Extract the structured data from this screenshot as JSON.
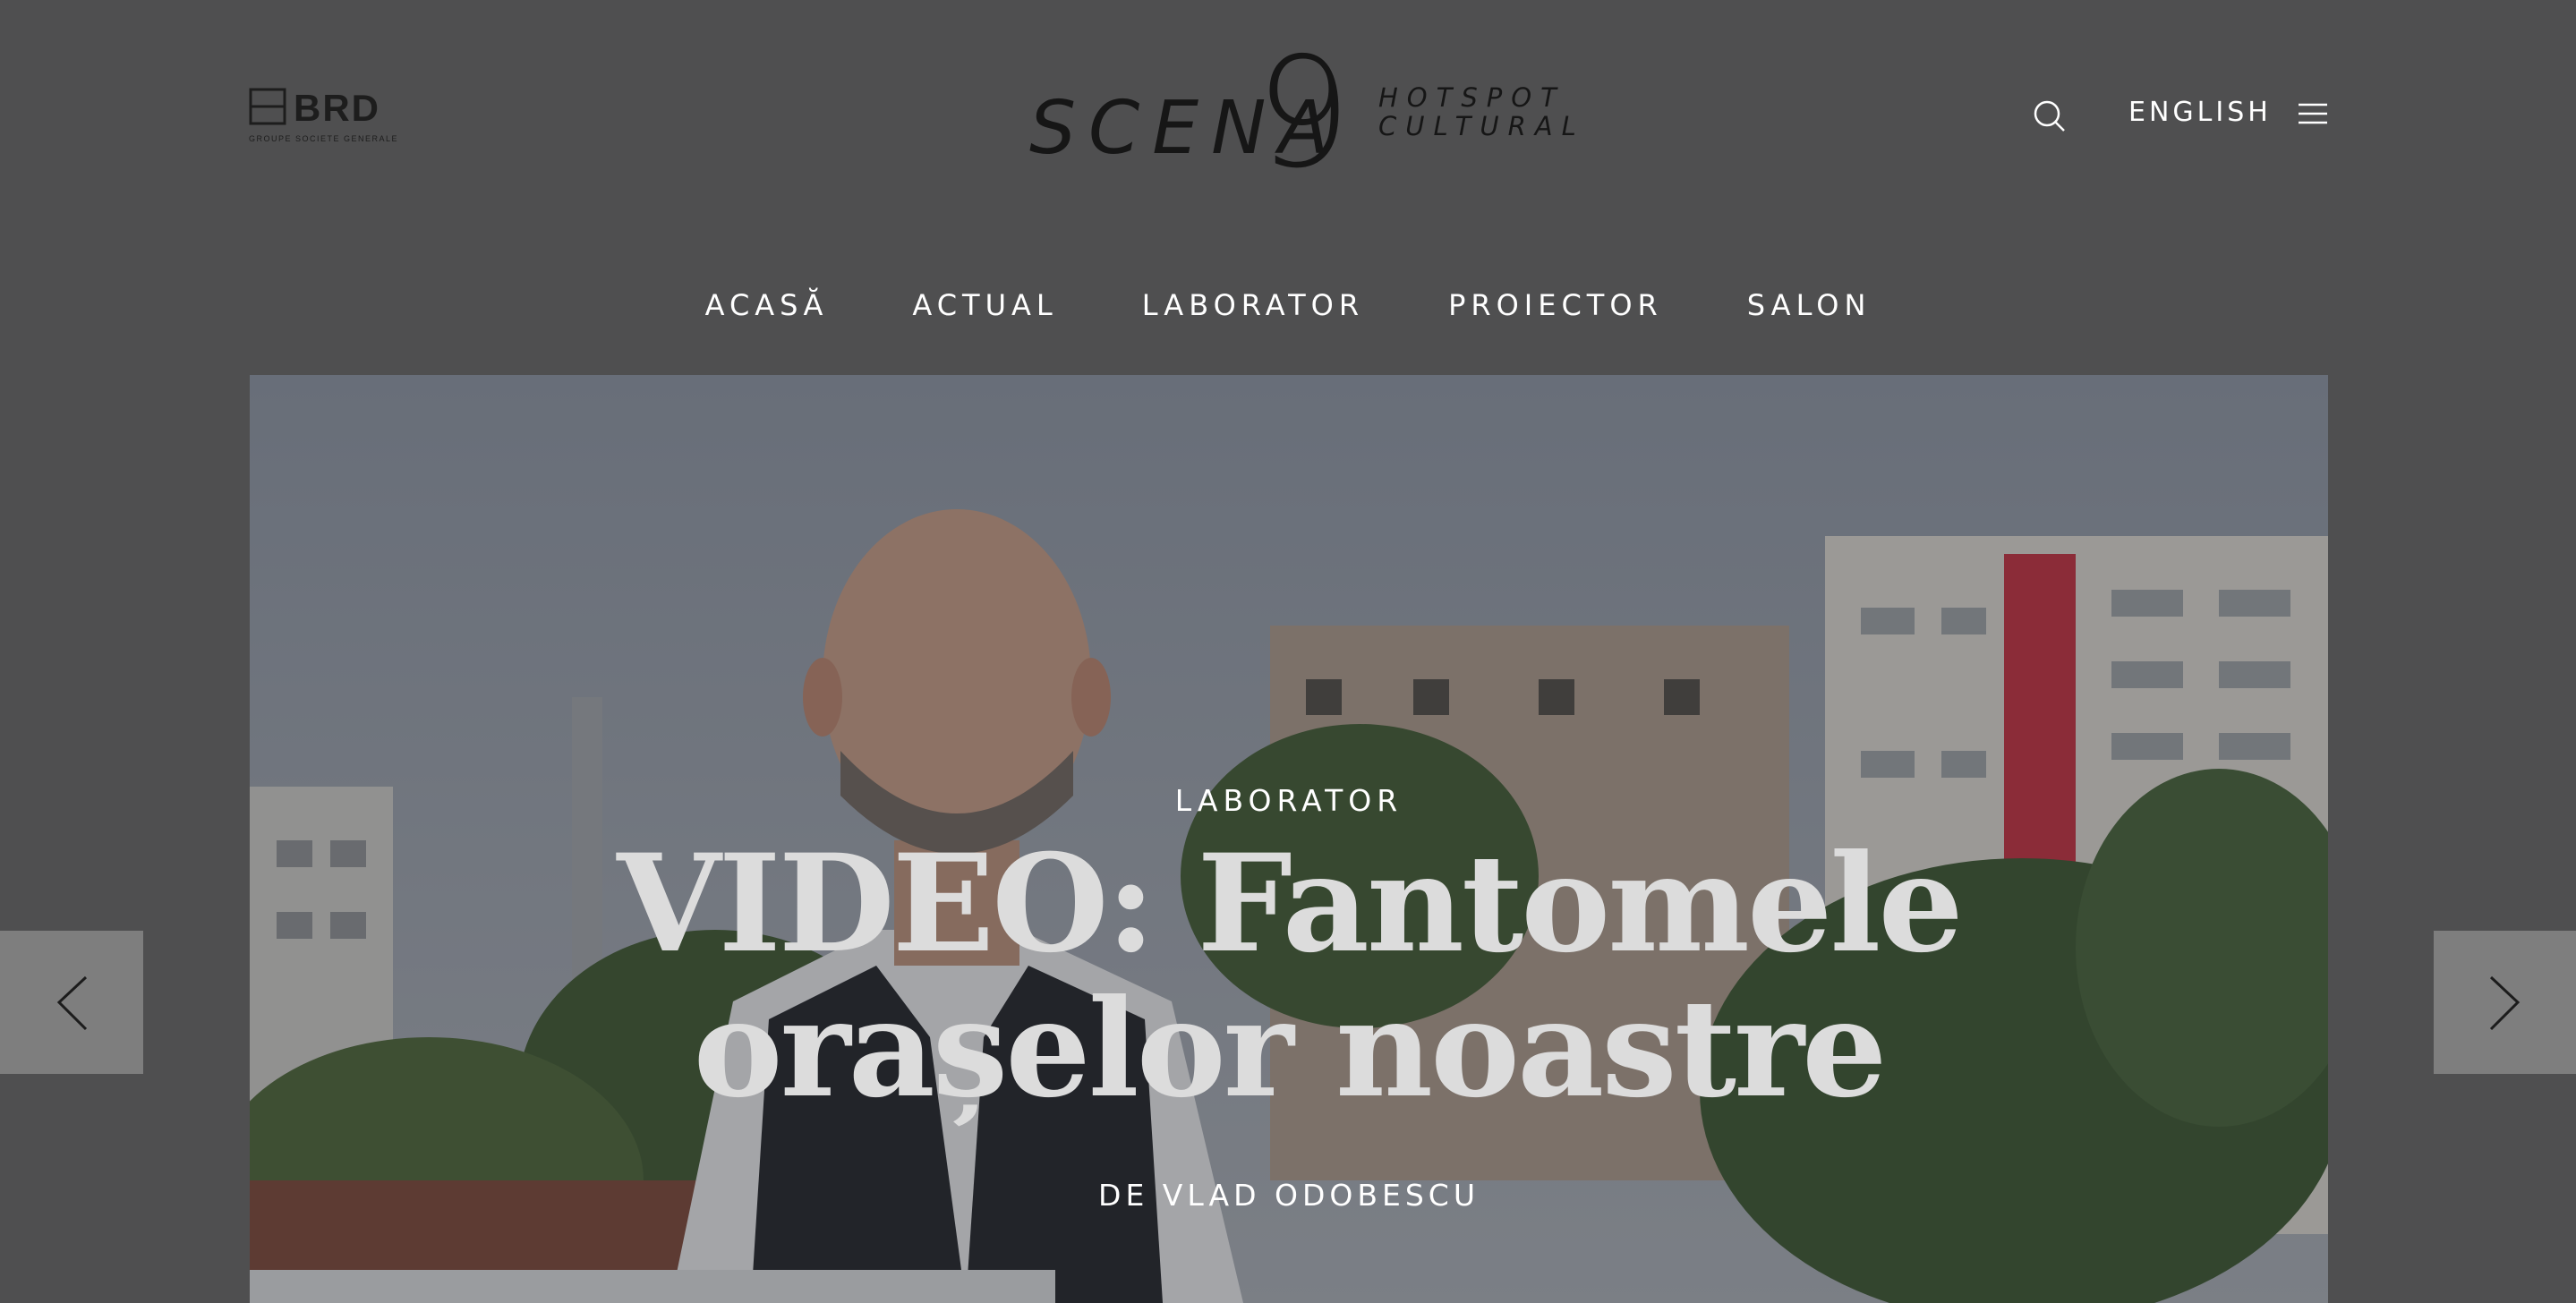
{
  "header": {
    "brd_logo": {
      "name": "BRD",
      "subtitle": "GROUPE SOCIETE GENERALE"
    },
    "site_logo": {
      "word": "SCENA",
      "number": "9",
      "tagline_line1": "HOTSPOT",
      "tagline_line2": "CULTURAL"
    },
    "language_link": "ENGLISH",
    "icons": {
      "search": "search-icon",
      "menu": "hamburger-menu-icon"
    }
  },
  "nav": {
    "items": [
      {
        "label": "ACASĂ"
      },
      {
        "label": "ACTUAL"
      },
      {
        "label": "LABORATOR"
      },
      {
        "label": "PROIECTOR"
      },
      {
        "label": "SALON"
      }
    ]
  },
  "hero": {
    "category": "LABORATOR",
    "title": "VIDEO: Fantomele orașelor noastre",
    "author": "DE VLAD ODOBESCU"
  },
  "carousel": {
    "prev_icon": "chevron-left-icon",
    "next_icon": "chevron-right-icon"
  },
  "colors": {
    "page_background": "#4f4f50",
    "logo_ink": "#161616",
    "arrow_button_bg": "#7e7e7e",
    "nav_text": "#ffffff"
  }
}
